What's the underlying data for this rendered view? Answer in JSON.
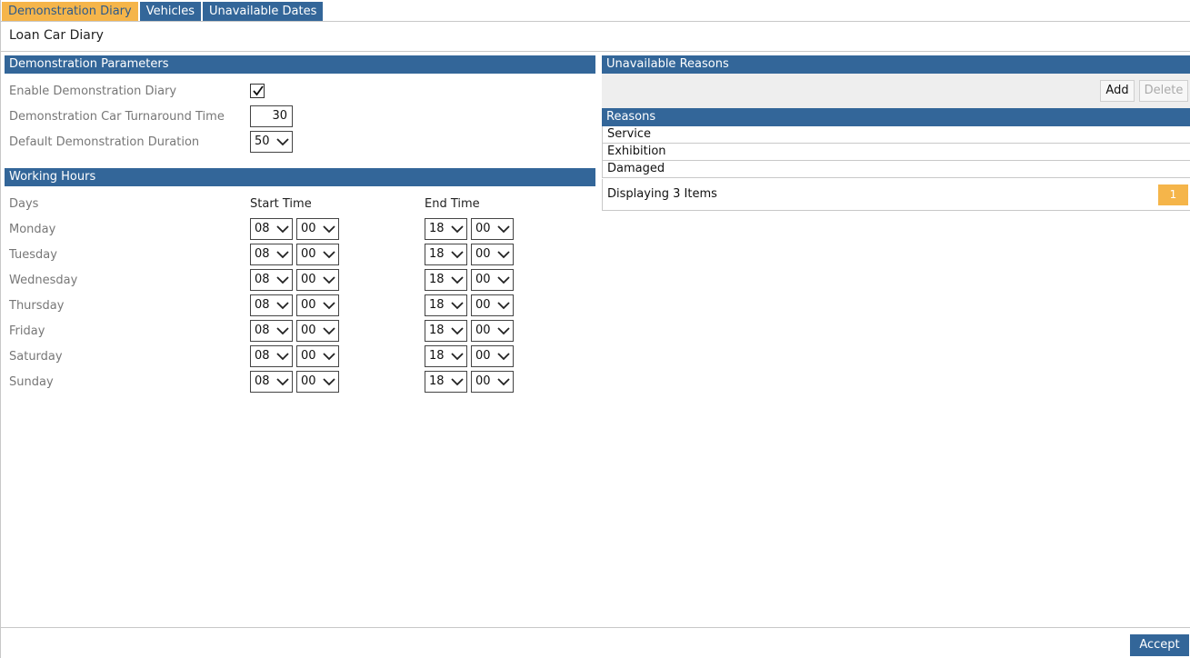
{
  "tabs": [
    {
      "label": "Demonstration Diary",
      "active": true
    },
    {
      "label": "Vehicles",
      "active": false
    },
    {
      "label": "Unavailable Dates",
      "active": false
    }
  ],
  "page": {
    "title": "Loan Car Diary"
  },
  "demo": {
    "section_title": "Demonstration Parameters",
    "enable_label": "Enable Demonstration Diary",
    "enable_checked": true,
    "turnaround_label": "Demonstration Car Turnaround Time",
    "turnaround_value": "30",
    "duration_label": "Default Demonstration Duration",
    "duration_value": "50"
  },
  "hours": {
    "section_title": "Working Hours",
    "col_days": "Days",
    "col_start": "Start Time",
    "col_end": "End Time",
    "rows": [
      {
        "day": "Monday",
        "start_h": "08",
        "start_m": "00",
        "end_h": "18",
        "end_m": "00"
      },
      {
        "day": "Tuesday",
        "start_h": "08",
        "start_m": "00",
        "end_h": "18",
        "end_m": "00"
      },
      {
        "day": "Wednesday",
        "start_h": "08",
        "start_m": "00",
        "end_h": "18",
        "end_m": "00"
      },
      {
        "day": "Thursday",
        "start_h": "08",
        "start_m": "00",
        "end_h": "18",
        "end_m": "00"
      },
      {
        "day": "Friday",
        "start_h": "08",
        "start_m": "00",
        "end_h": "18",
        "end_m": "00"
      },
      {
        "day": "Saturday",
        "start_h": "08",
        "start_m": "00",
        "end_h": "18",
        "end_m": "00"
      },
      {
        "day": "Sunday",
        "start_h": "08",
        "start_m": "00",
        "end_h": "18",
        "end_m": "00"
      }
    ]
  },
  "reasons": {
    "section_title": "Unavailable Reasons",
    "add_label": "Add",
    "delete_label": "Delete",
    "column": "Reasons",
    "items": [
      "Service",
      "Exhibition",
      "Damaged"
    ],
    "footer_text": "Displaying 3 Items",
    "page": "1"
  },
  "footer": {
    "accept_label": "Accept"
  },
  "colors": {
    "header": "#336699",
    "accent": "#f5b54a"
  }
}
